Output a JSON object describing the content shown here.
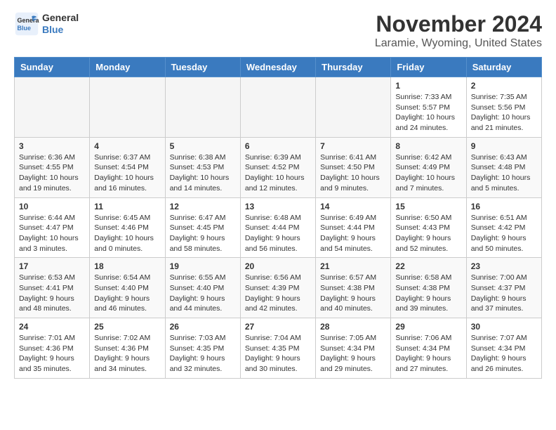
{
  "header": {
    "logo_line1": "General",
    "logo_line2": "Blue",
    "month": "November 2024",
    "location": "Laramie, Wyoming, United States"
  },
  "weekdays": [
    "Sunday",
    "Monday",
    "Tuesday",
    "Wednesday",
    "Thursday",
    "Friday",
    "Saturday"
  ],
  "weeks": [
    [
      {
        "day": "",
        "info": ""
      },
      {
        "day": "",
        "info": ""
      },
      {
        "day": "",
        "info": ""
      },
      {
        "day": "",
        "info": ""
      },
      {
        "day": "",
        "info": ""
      },
      {
        "day": "1",
        "info": "Sunrise: 7:33 AM\nSunset: 5:57 PM\nDaylight: 10 hours\nand 24 minutes."
      },
      {
        "day": "2",
        "info": "Sunrise: 7:35 AM\nSunset: 5:56 PM\nDaylight: 10 hours\nand 21 minutes."
      }
    ],
    [
      {
        "day": "3",
        "info": "Sunrise: 6:36 AM\nSunset: 4:55 PM\nDaylight: 10 hours\nand 19 minutes."
      },
      {
        "day": "4",
        "info": "Sunrise: 6:37 AM\nSunset: 4:54 PM\nDaylight: 10 hours\nand 16 minutes."
      },
      {
        "day": "5",
        "info": "Sunrise: 6:38 AM\nSunset: 4:53 PM\nDaylight: 10 hours\nand 14 minutes."
      },
      {
        "day": "6",
        "info": "Sunrise: 6:39 AM\nSunset: 4:52 PM\nDaylight: 10 hours\nand 12 minutes."
      },
      {
        "day": "7",
        "info": "Sunrise: 6:41 AM\nSunset: 4:50 PM\nDaylight: 10 hours\nand 9 minutes."
      },
      {
        "day": "8",
        "info": "Sunrise: 6:42 AM\nSunset: 4:49 PM\nDaylight: 10 hours\nand 7 minutes."
      },
      {
        "day": "9",
        "info": "Sunrise: 6:43 AM\nSunset: 4:48 PM\nDaylight: 10 hours\nand 5 minutes."
      }
    ],
    [
      {
        "day": "10",
        "info": "Sunrise: 6:44 AM\nSunset: 4:47 PM\nDaylight: 10 hours\nand 3 minutes."
      },
      {
        "day": "11",
        "info": "Sunrise: 6:45 AM\nSunset: 4:46 PM\nDaylight: 10 hours\nand 0 minutes."
      },
      {
        "day": "12",
        "info": "Sunrise: 6:47 AM\nSunset: 4:45 PM\nDaylight: 9 hours\nand 58 minutes."
      },
      {
        "day": "13",
        "info": "Sunrise: 6:48 AM\nSunset: 4:44 PM\nDaylight: 9 hours\nand 56 minutes."
      },
      {
        "day": "14",
        "info": "Sunrise: 6:49 AM\nSunset: 4:44 PM\nDaylight: 9 hours\nand 54 minutes."
      },
      {
        "day": "15",
        "info": "Sunrise: 6:50 AM\nSunset: 4:43 PM\nDaylight: 9 hours\nand 52 minutes."
      },
      {
        "day": "16",
        "info": "Sunrise: 6:51 AM\nSunset: 4:42 PM\nDaylight: 9 hours\nand 50 minutes."
      }
    ],
    [
      {
        "day": "17",
        "info": "Sunrise: 6:53 AM\nSunset: 4:41 PM\nDaylight: 9 hours\nand 48 minutes."
      },
      {
        "day": "18",
        "info": "Sunrise: 6:54 AM\nSunset: 4:40 PM\nDaylight: 9 hours\nand 46 minutes."
      },
      {
        "day": "19",
        "info": "Sunrise: 6:55 AM\nSunset: 4:40 PM\nDaylight: 9 hours\nand 44 minutes."
      },
      {
        "day": "20",
        "info": "Sunrise: 6:56 AM\nSunset: 4:39 PM\nDaylight: 9 hours\nand 42 minutes."
      },
      {
        "day": "21",
        "info": "Sunrise: 6:57 AM\nSunset: 4:38 PM\nDaylight: 9 hours\nand 40 minutes."
      },
      {
        "day": "22",
        "info": "Sunrise: 6:58 AM\nSunset: 4:38 PM\nDaylight: 9 hours\nand 39 minutes."
      },
      {
        "day": "23",
        "info": "Sunrise: 7:00 AM\nSunset: 4:37 PM\nDaylight: 9 hours\nand 37 minutes."
      }
    ],
    [
      {
        "day": "24",
        "info": "Sunrise: 7:01 AM\nSunset: 4:36 PM\nDaylight: 9 hours\nand 35 minutes."
      },
      {
        "day": "25",
        "info": "Sunrise: 7:02 AM\nSunset: 4:36 PM\nDaylight: 9 hours\nand 34 minutes."
      },
      {
        "day": "26",
        "info": "Sunrise: 7:03 AM\nSunset: 4:35 PM\nDaylight: 9 hours\nand 32 minutes."
      },
      {
        "day": "27",
        "info": "Sunrise: 7:04 AM\nSunset: 4:35 PM\nDaylight: 9 hours\nand 30 minutes."
      },
      {
        "day": "28",
        "info": "Sunrise: 7:05 AM\nSunset: 4:34 PM\nDaylight: 9 hours\nand 29 minutes."
      },
      {
        "day": "29",
        "info": "Sunrise: 7:06 AM\nSunset: 4:34 PM\nDaylight: 9 hours\nand 27 minutes."
      },
      {
        "day": "30",
        "info": "Sunrise: 7:07 AM\nSunset: 4:34 PM\nDaylight: 9 hours\nand 26 minutes."
      }
    ]
  ]
}
